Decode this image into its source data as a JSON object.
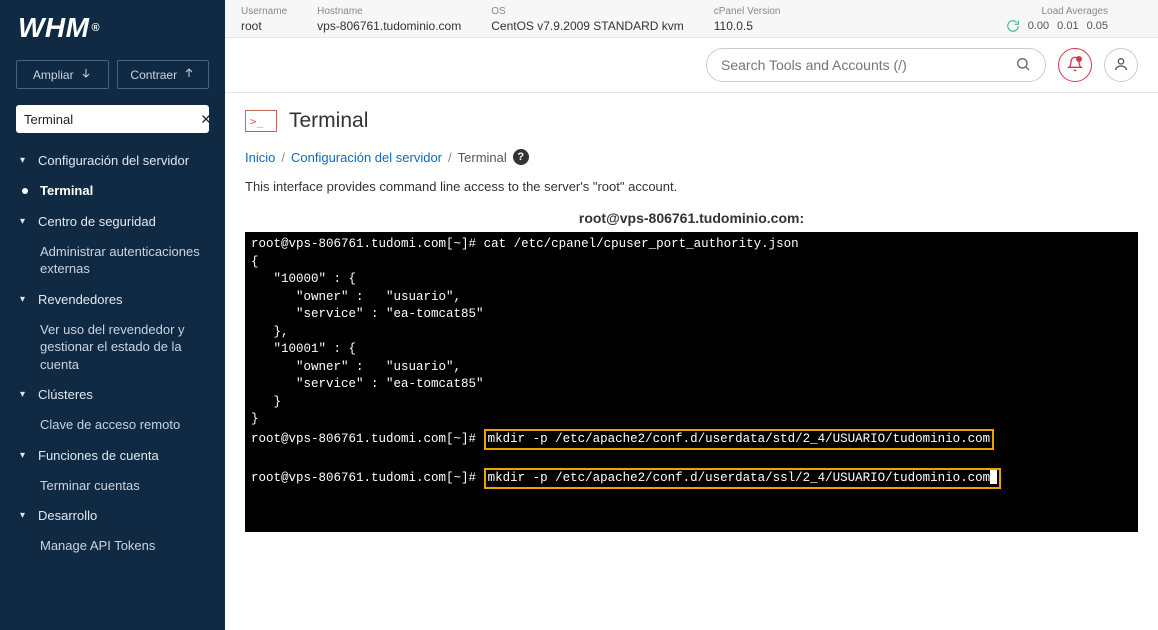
{
  "logo": {
    "text": "WHM",
    "reg": "®"
  },
  "sidebar_buttons": {
    "expand": "Ampliar",
    "collapse": "Contraer"
  },
  "filter": {
    "value": "Terminal"
  },
  "nav": {
    "g0": {
      "label": "Configuración del servidor"
    },
    "g0_i0": "Terminal",
    "g1": {
      "label": "Centro de seguridad"
    },
    "g1_i0": "Administrar autenticaciones externas",
    "g2": {
      "label": "Revendedores"
    },
    "g2_i0": "Ver uso del revendedor y gestionar el estado de la cuenta",
    "g3": {
      "label": "Clústeres"
    },
    "g3_i0": "Clave de acceso remoto",
    "g4": {
      "label": "Funciones de cuenta"
    },
    "g4_i0": "Terminar cuentas",
    "g5": {
      "label": "Desarrollo"
    },
    "g5_i0": "Manage API Tokens"
  },
  "topbar": {
    "username": {
      "label": "Username",
      "value": "root"
    },
    "hostname": {
      "label": "Hostname",
      "value": "vps-806761.tudominio.com"
    },
    "os": {
      "label": "OS",
      "value": "CentOS v7.9.2009 STANDARD kvm"
    },
    "cpver": {
      "label": "cPanel Version",
      "value": "110.0.5"
    },
    "load": {
      "label": "Load Averages",
      "v1": "0.00",
      "v2": "0.01",
      "v3": "0.05"
    }
  },
  "search": {
    "placeholder": "Search Tools and Accounts (/)"
  },
  "page": {
    "title": "Terminal",
    "bc_home": "Inicio",
    "bc_mid": "Configuración del servidor",
    "bc_last": "Terminal",
    "intro": "This interface provides command line access to the server's \"root\" account.",
    "term_host": "root@vps-806761.tudominio.com:"
  },
  "terminal": {
    "prompt": "root@vps-806761.tudomi.com[~]#",
    "cmd_cat": "cat /etc/cpanel/cpuser_port_authority.json",
    "json_open": "{",
    "l_10000_open": "   \"10000\" : {",
    "l_owner1": "      \"owner\" :   \"usuario\",",
    "l_service1": "      \"service\" : \"ea-tomcat85\"",
    "l_10000_close": "   },",
    "l_10001_open": "   \"10001\" : {",
    "l_owner2": "      \"owner\" :   \"usuario\",",
    "l_service2": "      \"service\" : \"ea-tomcat85\"",
    "l_10001_close": "   }",
    "json_close": "}",
    "cmd_mkdir_std": "mkdir -p /etc/apache2/conf.d/userdata/std/2_4/USUARIO/tudominio.com",
    "cmd_mkdir_ssl": "mkdir -p /etc/apache2/conf.d/userdata/ssl/2_4/USUARIO/tudominio.com"
  }
}
